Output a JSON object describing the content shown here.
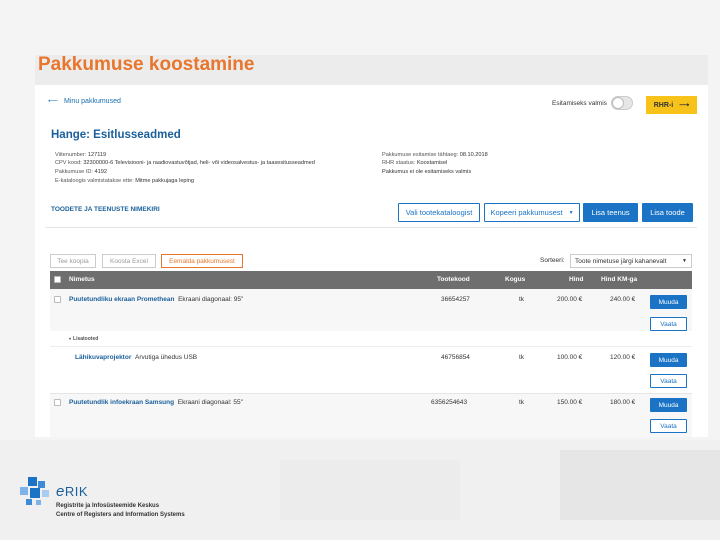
{
  "page_title": "Pakkumuse koostamine",
  "back_link": "Minu pakkumused",
  "toggle_label": "Esitamiseks valmis",
  "rhr_button": "RHR-i",
  "hange_title": "Hange: Esitlusseadmed",
  "meta_left": [
    {
      "label": "Viitenumber:",
      "value": "127119"
    },
    {
      "label": "CPV kood:",
      "value": "32300000-6 Televisiooni- ja raadiovastuvõtjad, heli- või videosalvestus- ja taasesitusseadmed"
    },
    {
      "label": "Pakkumuse ID:",
      "value": "4192"
    },
    {
      "label": "E-kataloogis valmistatakse ette:",
      "value": "Mitme pakkujaga leping"
    }
  ],
  "meta_right": [
    {
      "label": "Pakkumuse esitamise tähtaeg:",
      "value": "08.10.2018"
    },
    {
      "label": "RHR staatus:",
      "value": "Koostamisel"
    },
    {
      "label": "",
      "value": "Pakkumus ei ole esitamiseks valmis"
    }
  ],
  "section_title": "TOODETE JA TEENUSTE NIMEKIRI",
  "actions": {
    "catalog": "Vali tootekataloogist",
    "copy": "Kopeeri pakkumusest",
    "add_service": "Lisa teenus",
    "add_product": "Lisa toode"
  },
  "tools": {
    "copy": "Tee koopia",
    "excel": "Koosta Excel",
    "remove": "Eemalda pakkumusest"
  },
  "sort": {
    "label": "Sorteeri:",
    "value": "Toote nimetuse järgi kahanevalt"
  },
  "columns": {
    "name": "Nimetus",
    "code": "Tootekood",
    "qty": "Kogus",
    "price": "Hind",
    "price_vat": "Hind KM-ga"
  },
  "rows": [
    {
      "name": "Puutetundliku ekraan Promethean",
      "desc": "Ekraani diagonaal: 95\"",
      "code": "36654257",
      "qty": "tk",
      "price": "200.00 €",
      "price_vat": "240.00 €",
      "edit": "Muuda",
      "view": "Vaata"
    },
    {
      "name": "Lähikuvaprojektor",
      "desc": "Arvutiga ühedus USB",
      "code": "46756854",
      "qty": "tk",
      "price": "100.00 €",
      "price_vat": "120.00 €",
      "edit": "Muuda",
      "view": "Vaata"
    },
    {
      "name": "Puutetundlik infoekraan Samsung",
      "desc": "Ekraani diagonaal: 55\"",
      "code": "6356254643",
      "qty": "tk",
      "price": "150.00 €",
      "price_vat": "180.00 €",
      "edit": "Muuda",
      "view": "Vaata"
    }
  ],
  "addon_label": "Lisatooted",
  "logo": {
    "mark": "RIK",
    "line1": "Registrite ja Infosüsteemide Keskus",
    "line2": "Centre of Registers and Information Systems"
  },
  "colors": {
    "accent": "#e8762c",
    "primary": "#1a73c4",
    "yellow": "#f7c21a",
    "header_gray": "#6e6e6e"
  }
}
